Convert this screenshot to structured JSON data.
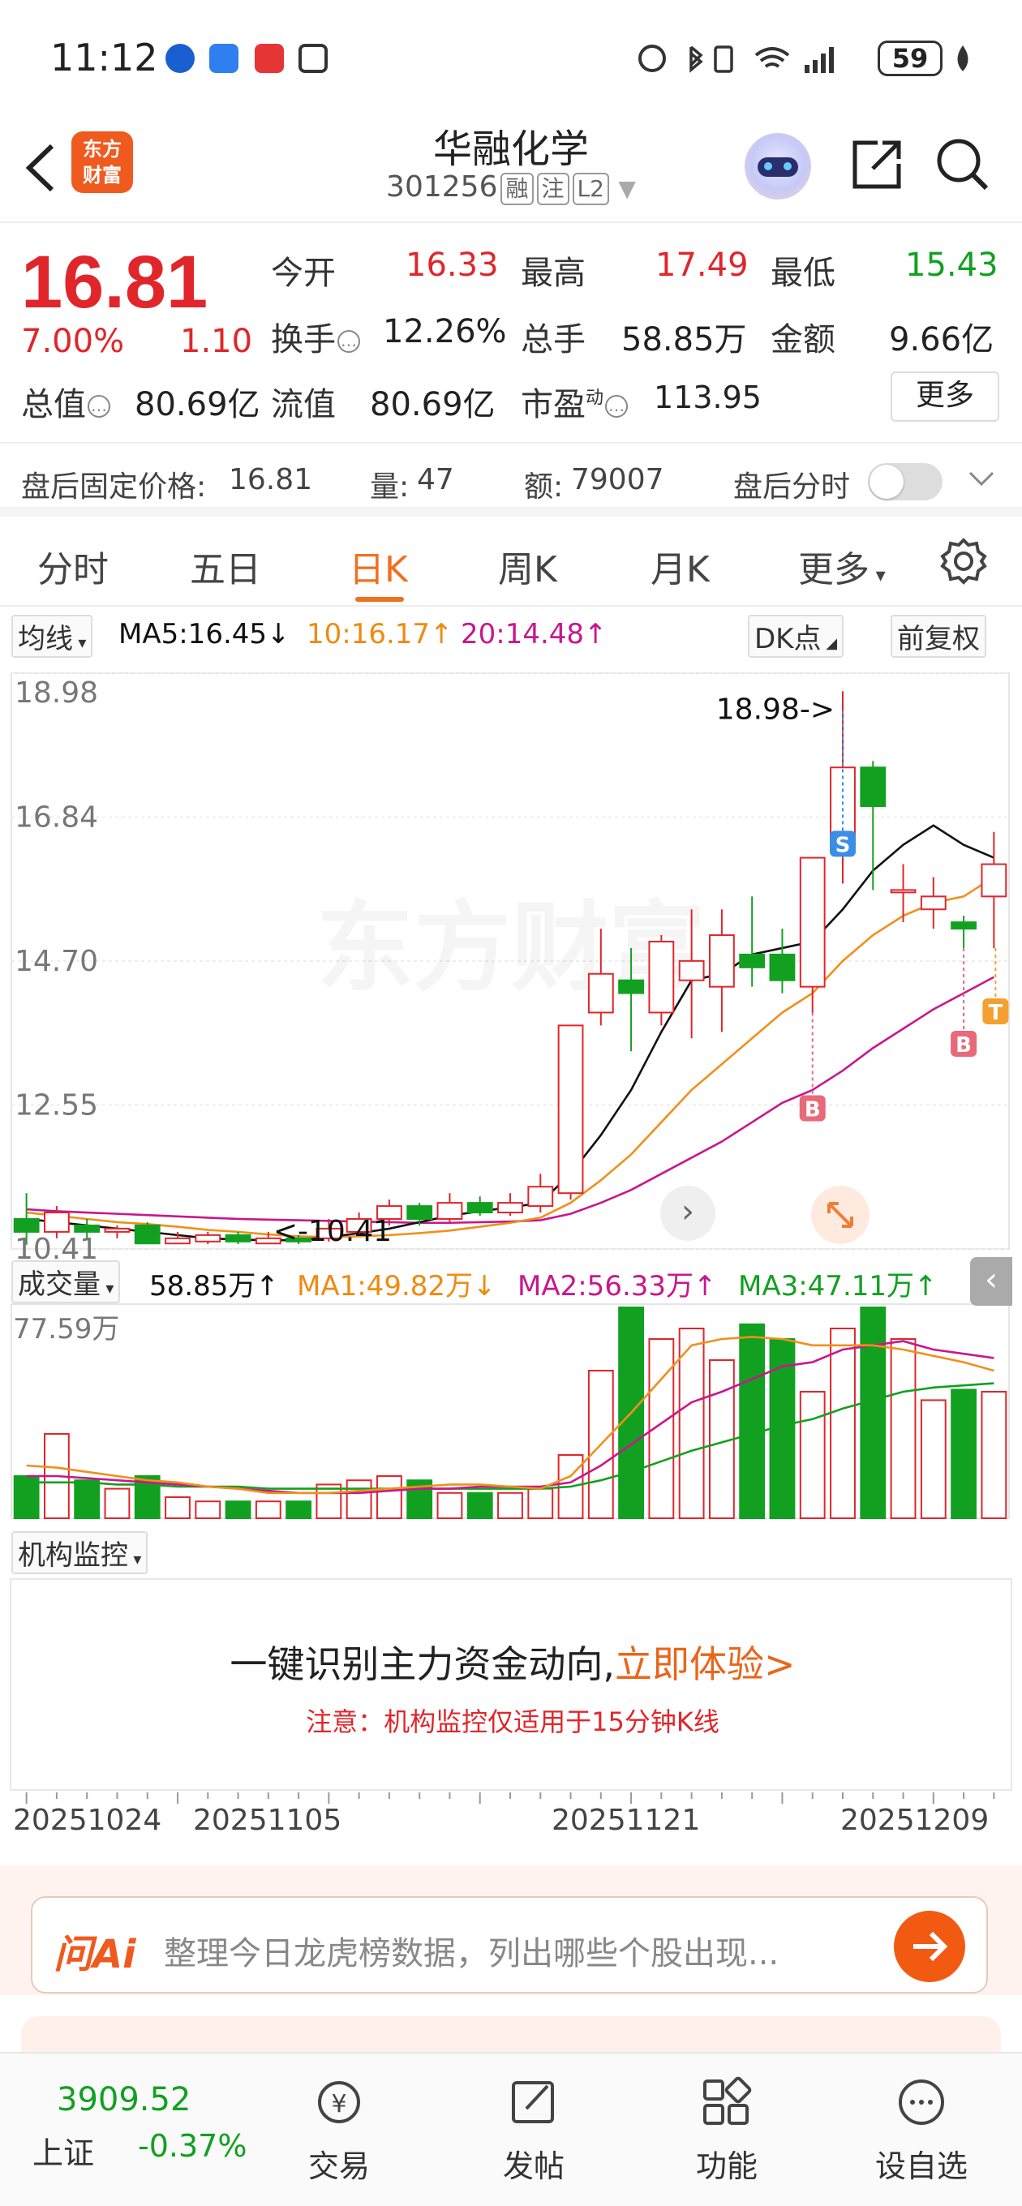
{
  "status_bar": {
    "time": "11:12",
    "battery": "59",
    "icons": [
      "browser-icon",
      "voice-icon",
      "app-red-icon",
      "nfc-icon",
      "alarm-icon",
      "bluetooth-icon",
      "vibrate-icon",
      "wifi-icon",
      "signal-icon",
      "leaf-icon"
    ]
  },
  "header": {
    "logo_line1": "东方",
    "logo_line2": "财富",
    "stock_name": "华融化学",
    "stock_code": "301256",
    "tags": [
      "融",
      "注",
      "L2"
    ]
  },
  "quote": {
    "price": "16.81",
    "pct": "7.00%",
    "change": "1.10",
    "open_label": "今开",
    "open": "16.33",
    "high_label": "最高",
    "high": "17.49",
    "low_label": "最低",
    "low": "15.43",
    "turnover_label": "换手",
    "turnover": "12.26%",
    "volume_label": "总手",
    "volume": "58.85万",
    "amount_label": "金额",
    "amount": "9.66亿",
    "mktcap_label": "总值",
    "mktcap": "80.69亿",
    "float_label": "流值",
    "float": "80.69亿",
    "pe_label": "市盈",
    "pe_sup": "动",
    "pe": "113.95",
    "more": "更多"
  },
  "after_hours": {
    "price_label": "盘后固定价格:",
    "price": "16.81",
    "vol_label": "量:",
    "vol": "47",
    "amt_label": "额:",
    "amt": "79007",
    "timeshare_label": "盘后分时"
  },
  "tabs": [
    "分时",
    "五日",
    "日K",
    "周K",
    "月K",
    "更多"
  ],
  "active_tab": "日K",
  "ma_legend": {
    "selector": "均线",
    "ma5": "MA5:16.45↓",
    "ma10": "10:16.17↑",
    "ma20": "20:14.48↑",
    "dk": "DK点",
    "fq": "前复权"
  },
  "vol_legend": {
    "selector": "成交量",
    "vol": "58.85万↑",
    "ma1": "MA1:49.82万↓",
    "ma2": "MA2:56.33万↑",
    "ma3": "MA3:47.11万↑"
  },
  "colors": {
    "up": "#e0262b",
    "down": "#12a021",
    "ma5": "#111111",
    "ma10": "#f0901a",
    "ma20": "#c8178c",
    "accent": "#f07020"
  },
  "chart_data": {
    "type": "candlestick",
    "y_ticks": [
      "18.98",
      "16.84",
      "14.70",
      "12.55",
      "10.41"
    ],
    "ylim": [
      10.41,
      18.98
    ],
    "max_annotation": "18.98->",
    "min_annotation": "<-10.41",
    "vol_max_label": "77.59万",
    "dates": [
      "20251024",
      "20251105",
      "20251121",
      "20251209"
    ],
    "candles": [
      {
        "o": 10.8,
        "c": 10.6,
        "h": 11.2,
        "l": 10.4
      },
      {
        "o": 10.6,
        "c": 10.9,
        "h": 11.0,
        "l": 10.5
      },
      {
        "o": 10.7,
        "c": 10.6,
        "h": 10.8,
        "l": 10.5
      },
      {
        "o": 10.6,
        "c": 10.65,
        "h": 10.7,
        "l": 10.5
      },
      {
        "o": 10.7,
        "c": 10.42,
        "h": 10.75,
        "l": 10.41
      },
      {
        "o": 10.42,
        "c": 10.5,
        "h": 10.6,
        "l": 10.41
      },
      {
        "o": 10.45,
        "c": 10.55,
        "h": 10.6,
        "l": 10.41
      },
      {
        "o": 10.55,
        "c": 10.45,
        "h": 10.6,
        "l": 10.41
      },
      {
        "o": 10.42,
        "c": 10.5,
        "h": 10.6,
        "l": 10.41
      },
      {
        "o": 10.5,
        "c": 10.45,
        "h": 10.55,
        "l": 10.41
      },
      {
        "o": 10.5,
        "c": 10.65,
        "h": 10.8,
        "l": 10.45
      },
      {
        "o": 10.6,
        "c": 10.8,
        "h": 10.9,
        "l": 10.55
      },
      {
        "o": 10.8,
        "c": 11.0,
        "h": 11.1,
        "l": 10.7
      },
      {
        "o": 11.0,
        "c": 10.8,
        "h": 11.05,
        "l": 10.7
      },
      {
        "o": 10.8,
        "c": 11.05,
        "h": 11.2,
        "l": 10.75
      },
      {
        "o": 11.05,
        "c": 10.9,
        "h": 11.15,
        "l": 10.85
      },
      {
        "o": 10.9,
        "c": 11.05,
        "h": 11.2,
        "l": 10.85
      },
      {
        "o": 11.0,
        "c": 11.3,
        "h": 11.5,
        "l": 10.9
      },
      {
        "o": 11.2,
        "c": 13.8,
        "h": 13.8,
        "l": 11.1
      },
      {
        "o": 14.0,
        "c": 14.6,
        "h": 15.3,
        "l": 13.8
      },
      {
        "o": 14.5,
        "c": 14.3,
        "h": 15.0,
        "l": 13.4
      },
      {
        "o": 14.0,
        "c": 15.1,
        "h": 15.2,
        "l": 13.8
      },
      {
        "o": 14.5,
        "c": 14.8,
        "h": 15.6,
        "l": 13.6
      },
      {
        "o": 14.4,
        "c": 15.2,
        "h": 15.6,
        "l": 13.7
      },
      {
        "o": 14.9,
        "c": 14.7,
        "h": 15.8,
        "l": 14.4
      },
      {
        "o": 14.9,
        "c": 14.5,
        "h": 15.3,
        "l": 14.3
      },
      {
        "o": 14.4,
        "c": 16.4,
        "h": 16.4,
        "l": 14.0
      },
      {
        "o": 16.7,
        "c": 17.8,
        "h": 18.98,
        "l": 16.0
      },
      {
        "o": 17.8,
        "c": 17.2,
        "h": 17.9,
        "l": 15.9
      },
      {
        "o": 15.9,
        "c": 15.9,
        "h": 16.3,
        "l": 15.4
      },
      {
        "o": 15.6,
        "c": 15.8,
        "h": 16.1,
        "l": 15.3
      },
      {
        "o": 15.4,
        "c": 15.3,
        "h": 15.5,
        "l": 15.0
      },
      {
        "o": 15.8,
        "c": 16.3,
        "h": 16.8,
        "l": 15.0
      }
    ],
    "ma5": [
      10.8,
      10.75,
      10.7,
      10.65,
      10.6,
      10.55,
      10.5,
      10.48,
      10.47,
      10.47,
      10.52,
      10.58,
      10.65,
      10.75,
      10.85,
      10.92,
      10.98,
      11.05,
      11.5,
      12.1,
      12.8,
      13.7,
      14.5,
      14.6,
      14.9,
      15.0,
      15.1,
      15.6,
      16.2,
      16.6,
      16.9,
      16.6,
      16.4
    ],
    "ma10": [
      10.9,
      10.85,
      10.8,
      10.75,
      10.72,
      10.68,
      10.63,
      10.6,
      10.56,
      10.53,
      10.52,
      10.53,
      10.55,
      10.58,
      10.62,
      10.68,
      10.74,
      10.82,
      11.05,
      11.4,
      11.8,
      12.3,
      12.8,
      13.2,
      13.6,
      14.0,
      14.3,
      14.8,
      15.2,
      15.5,
      15.7,
      15.8,
      16.1
    ],
    "ma20": [
      10.95,
      10.92,
      10.9,
      10.88,
      10.86,
      10.84,
      10.82,
      10.8,
      10.79,
      10.78,
      10.77,
      10.76,
      10.75,
      10.74,
      10.74,
      10.75,
      10.76,
      10.78,
      10.88,
      11.05,
      11.25,
      11.5,
      11.75,
      12.0,
      12.3,
      12.6,
      12.8,
      13.1,
      13.45,
      13.75,
      14.05,
      14.3,
      14.55
    ],
    "volumes": [
      0.2,
      0.4,
      0.18,
      0.14,
      0.2,
      0.1,
      0.08,
      0.08,
      0.08,
      0.08,
      0.16,
      0.18,
      0.2,
      0.18,
      0.12,
      0.12,
      0.12,
      0.14,
      0.3,
      0.7,
      1.0,
      0.85,
      0.9,
      0.75,
      0.92,
      0.85,
      0.6,
      0.9,
      1.0,
      0.85,
      0.56,
      0.61,
      0.6
    ],
    "vol_ma1": [
      0.25,
      0.24,
      0.22,
      0.2,
      0.18,
      0.17,
      0.15,
      0.14,
      0.12,
      0.12,
      0.12,
      0.13,
      0.14,
      0.15,
      0.16,
      0.16,
      0.15,
      0.14,
      0.2,
      0.35,
      0.5,
      0.66,
      0.82,
      0.85,
      0.86,
      0.85,
      0.82,
      0.82,
      0.82,
      0.8,
      0.77,
      0.74,
      0.7
    ],
    "vol_ma2": [
      0.2,
      0.2,
      0.19,
      0.18,
      0.17,
      0.16,
      0.15,
      0.14,
      0.13,
      0.12,
      0.12,
      0.12,
      0.13,
      0.14,
      0.14,
      0.15,
      0.15,
      0.15,
      0.17,
      0.25,
      0.35,
      0.45,
      0.55,
      0.6,
      0.66,
      0.72,
      0.74,
      0.8,
      0.82,
      0.84,
      0.8,
      0.78,
      0.76
    ],
    "vol_ma3": [
      0.17,
      0.17,
      0.17,
      0.16,
      0.16,
      0.15,
      0.15,
      0.15,
      0.14,
      0.14,
      0.14,
      0.14,
      0.14,
      0.14,
      0.14,
      0.14,
      0.14,
      0.14,
      0.15,
      0.18,
      0.22,
      0.27,
      0.32,
      0.36,
      0.4,
      0.44,
      0.47,
      0.52,
      0.56,
      0.6,
      0.62,
      0.63,
      0.64
    ],
    "markers": [
      {
        "label": "S",
        "color": "#3a8ee6",
        "idx": 27
      },
      {
        "label": "B",
        "color": "#e86a7a",
        "idx": 26
      },
      {
        "label": "B",
        "color": "#e86a7a",
        "idx": 31
      },
      {
        "label": "T",
        "color": "#f3a030",
        "idx": 32
      }
    ]
  },
  "institution": {
    "selector": "机构监控",
    "line1": "一键识别主力资金动向,",
    "line1_link": "立即体验>",
    "line2": "注意：机构监控仅适用于15分钟K线"
  },
  "ai": {
    "logo": "问Ai",
    "placeholder": "整理今日龙虎榜数据，列出哪些个股出现..."
  },
  "bottom_nav": {
    "index_value": "3909.52",
    "index_name": "上证",
    "index_change": "-0.37%",
    "items": [
      "交易",
      "发帖",
      "功能",
      "设自选"
    ]
  },
  "watermark": "东方财富"
}
